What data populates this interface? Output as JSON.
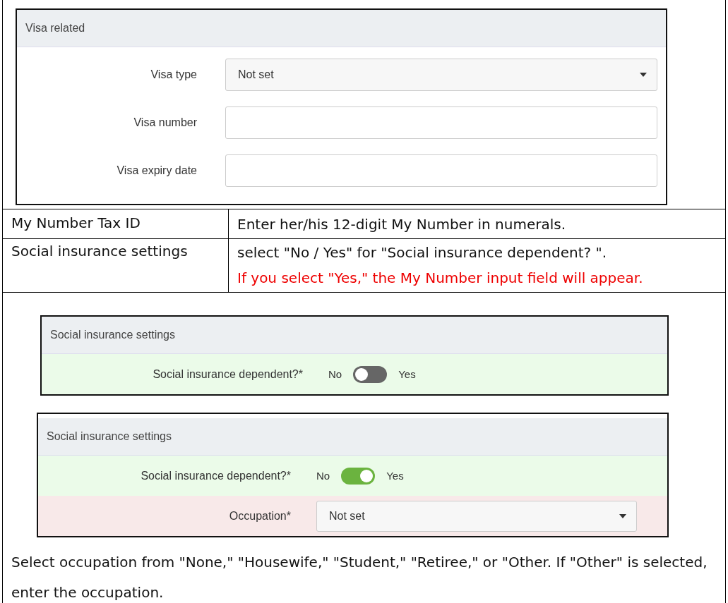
{
  "visa_panel": {
    "title": "Visa related",
    "fields": [
      {
        "label": "Visa type",
        "kind": "select",
        "value": "Not set"
      },
      {
        "label": "Visa number",
        "kind": "input"
      },
      {
        "label": "Visa expiry date",
        "kind": "input"
      }
    ]
  },
  "rows": [
    {
      "term": "My Number Tax ID",
      "lines": [
        {
          "text": "Enter her/his 12-digit My Number in numerals.",
          "kind": "normal"
        }
      ]
    },
    {
      "term": "Social insurance settings",
      "lines": [
        {
          "text": "select \"No / Yes\" for \"Social insurance dependent? \".",
          "kind": "normal"
        },
        {
          "text": "If you select \"Yes,\" the My Number input field will appear.",
          "kind": "warning"
        }
      ]
    }
  ],
  "social_panels": [
    {
      "title": "Social insurance settings",
      "toggle": {
        "label": "Social insurance dependent?*",
        "off_label": "No",
        "on_label": "Yes",
        "on": false
      }
    },
    {
      "title": "Social insurance settings",
      "toggle": {
        "label": "Social insurance dependent?*",
        "off_label": "No",
        "on_label": "Yes",
        "on": true
      },
      "occupation": {
        "label": "Occupation*",
        "value": "Not set"
      }
    }
  ],
  "note": "Select occupation from \"None,\" \"Housewife,\" \"Student,\" \"Retiree,\" or \"Other. If \"Other\" is selected, enter the occupation."
}
